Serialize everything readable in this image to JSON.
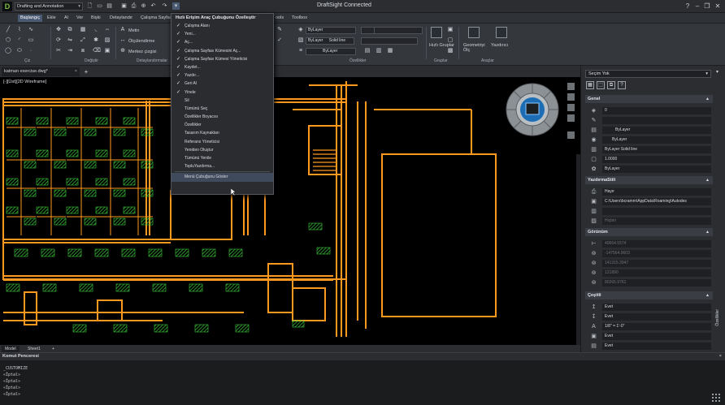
{
  "titlebar": {
    "logo": "D",
    "workspace": "Drafting and Annotation",
    "app_title": "DraftSight Connected",
    "help": "?",
    "minimize": "–",
    "restore": "❐",
    "close": "✕"
  },
  "menu": {
    "items": [
      "Başlangıç",
      "Ekle",
      "Al",
      "Ver",
      "Bişki",
      "Detaylandır",
      "Çalışma Sayfası",
      "ools",
      "Toolbox"
    ],
    "active": "Başlangıç"
  },
  "ribbon": {
    "groups": [
      "Çiz",
      "Değiştir",
      "Detaylandırmalar",
      "Özellikler",
      "Gruplar",
      "Araçlar"
    ],
    "detail_buttons": [
      "Metin",
      "Ölçülendirme",
      "Merkez çizgisi"
    ],
    "layer_combo": "ByLayer",
    "color_combo": "ByLayer",
    "linestyle_combo": "Solid line",
    "lineweight_combo": "ByLayer",
    "group_tools": [
      "Hızlı Gruplar"
    ],
    "tool_buttons": [
      "Geometriyi Ölç",
      "Yazdırıcı"
    ]
  },
  "doc_tab": {
    "name": "katman exercise.dwg*",
    "close": "×",
    "add": "+"
  },
  "viewport": {
    "label": "[-][Üst][2D Wireframe]"
  },
  "command_dropdown": {
    "header": "Hızlı Erişim Araç Çubuğunu Özelleştir",
    "items": [
      {
        "label": "Çalışma Alanı",
        "checked": true
      },
      {
        "label": "Yeni...",
        "checked": true
      },
      {
        "label": "Aç...",
        "checked": true
      },
      {
        "label": "Çalışma Sayfası Kümesini Aç...",
        "checked": true
      },
      {
        "label": "Çalışma Sayfası Kümesi Yöneticisi",
        "checked": true
      },
      {
        "label": "Kaydet...",
        "checked": true
      },
      {
        "label": "Yazdır...",
        "checked": true
      },
      {
        "label": "Geri Al",
        "checked": true
      },
      {
        "label": "Yinele",
        "checked": true
      },
      {
        "label": "Sil",
        "checked": false
      },
      {
        "label": "Tümünü Seç",
        "checked": false
      },
      {
        "label": "Özellikler Boyacısı",
        "checked": false
      },
      {
        "label": "Özellikler",
        "checked": false
      },
      {
        "label": "Tasarım Kaynakları",
        "checked": false
      },
      {
        "label": "Referans Yöneticisi",
        "checked": false
      },
      {
        "label": "Yeniden Oluştur",
        "checked": false
      },
      {
        "label": "Tümünü Yenile",
        "checked": false
      },
      {
        "label": "TopluYazdırma...",
        "checked": false
      }
    ],
    "footer": "Menü Çubuğunu Göster"
  },
  "layout_tabs": [
    "Model",
    "Sheet1",
    "+"
  ],
  "command_window": {
    "title": "Komut Penceresi",
    "close": "×",
    "lines": [
      "_CUSTOMIZE",
      "«İptal»",
      "«İptal»",
      "«İptal»",
      "«İptal»"
    ]
  },
  "properties": {
    "selection": "Seçim Yok",
    "sections": {
      "general": "Genel",
      "print_style": "YazdırmaStili",
      "view": "Görünüm",
      "misc": "Çeşitli"
    },
    "general": [
      "0",
      "",
      "ByLayer",
      "ByLayer",
      "ByLayer    Solid line",
      "1.0000",
      "ByLayer"
    ],
    "print_style": [
      "Hayır",
      "C:\\Users\\bcramm\\AppData\\Roaming\\Autodes",
      "",
      "Hiçbiri"
    ],
    "view": [
      "40664.5574",
      "-147564.9603",
      "141315.3947",
      "121890",
      "80265.9761"
    ],
    "misc": [
      "Evet",
      "Evet",
      "1/8\" = 1'-0\"",
      "Evet",
      "Evet"
    ],
    "side_tab": "Özellikler"
  },
  "colors": {
    "wall": "#ff9a1f",
    "hatch": "#3cc83c",
    "panel": "#2b2d30",
    "accent": "#4a5a72"
  }
}
